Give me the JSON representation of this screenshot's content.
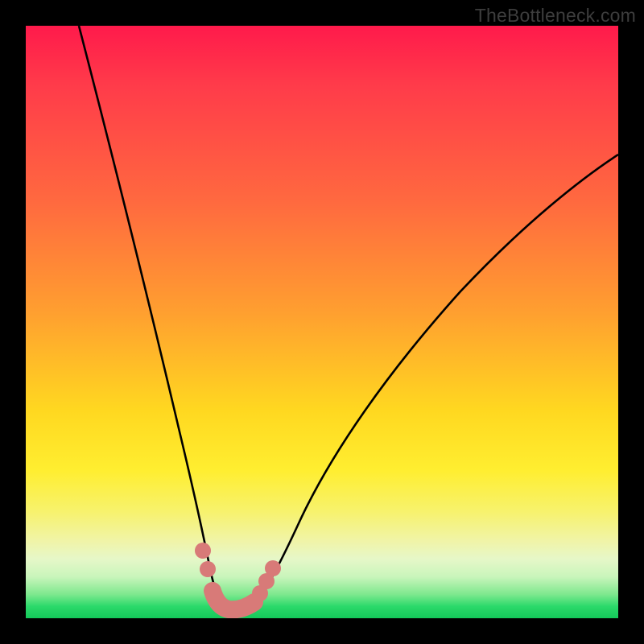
{
  "watermark": "TheBottleneck.com",
  "colors": {
    "background": "#000000",
    "gradient_top": "#ff1a4b",
    "gradient_mid": "#ffd820",
    "gradient_bottom": "#14c95a",
    "curve": "#000000",
    "marker": "#d87a78"
  },
  "chart_data": {
    "type": "line",
    "title": "",
    "xlabel": "",
    "ylabel": "",
    "xlim": [
      0,
      100
    ],
    "ylim": [
      0,
      100
    ],
    "note": "Axes unlabeled in source image; x and y are normalized 0–100. y≈0 is the minimum (green band), y≈100 is the maximum (top).",
    "series": [
      {
        "name": "curve",
        "x": [
          9,
          12,
          15,
          18,
          21,
          24,
          26,
          28,
          30,
          31,
          32,
          33,
          34,
          35,
          37,
          39,
          41,
          44,
          48,
          54,
          60,
          68,
          76,
          84,
          92,
          100
        ],
        "y": [
          100,
          84,
          70,
          56,
          44,
          33,
          24,
          17,
          11,
          7,
          4,
          2,
          1,
          1,
          1,
          2,
          4,
          8,
          14,
          23,
          33,
          44,
          54,
          62,
          69,
          75
        ]
      }
    ],
    "markers": [
      {
        "x": 30.0,
        "y": 11
      },
      {
        "x": 30.8,
        "y": 8
      },
      {
        "x": 39.5,
        "y": 4
      },
      {
        "x": 40.5,
        "y": 6
      },
      {
        "x": 41.5,
        "y": 8
      }
    ],
    "highlight_segment": {
      "x_start": 31.5,
      "x_end": 38.5,
      "y": 1
    }
  }
}
